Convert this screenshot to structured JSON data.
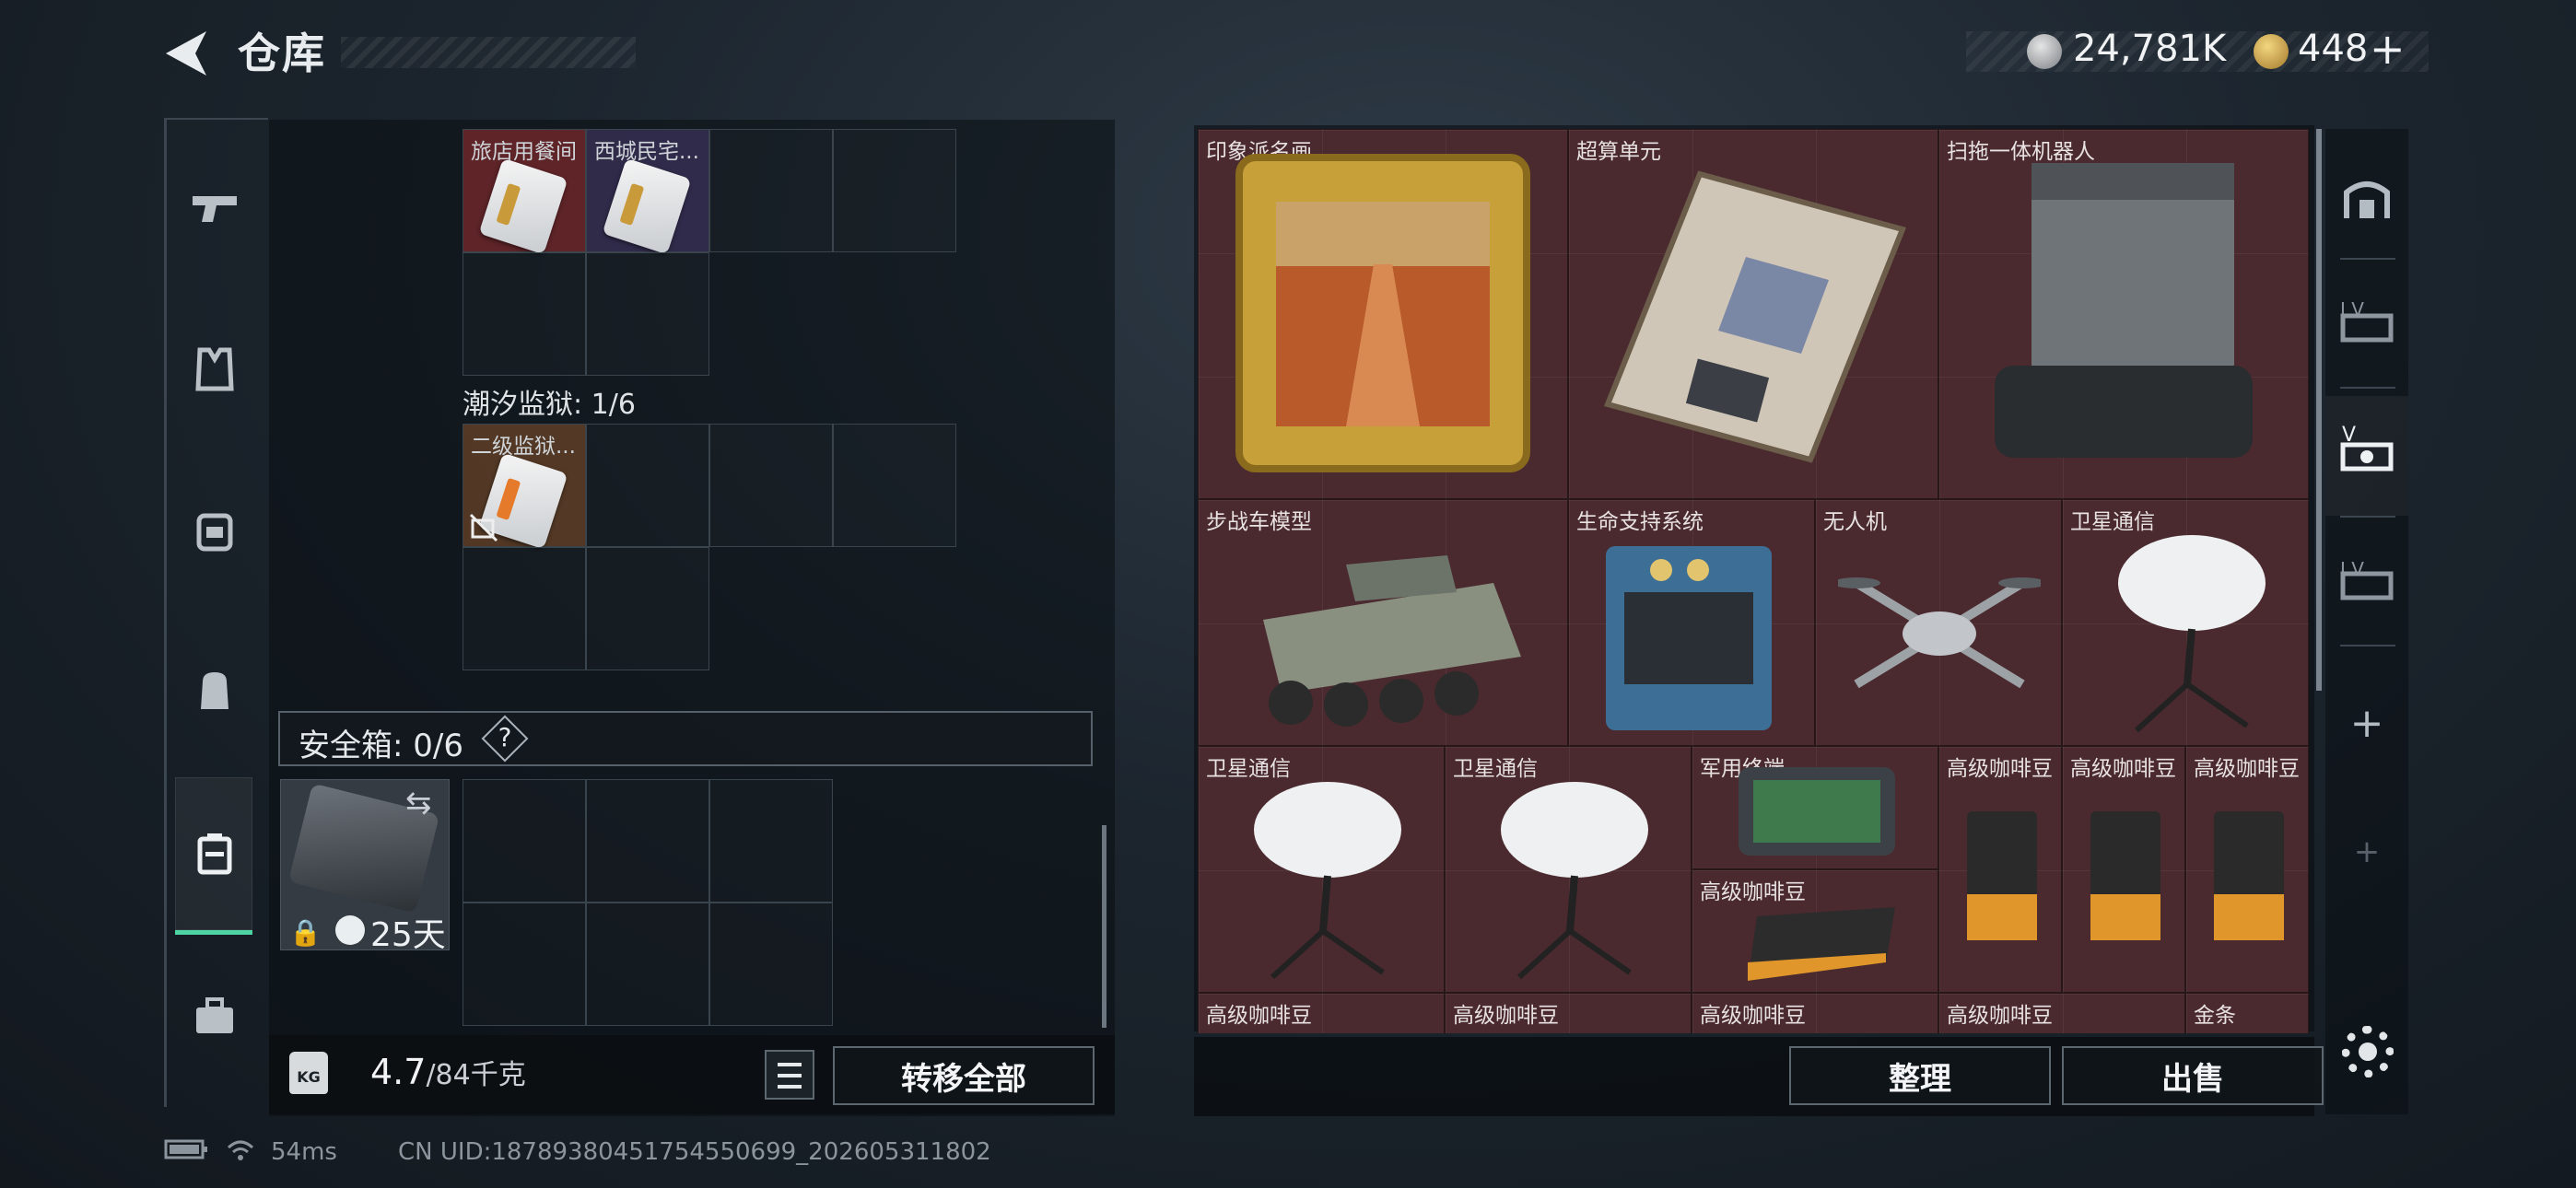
{
  "header": {
    "title": "仓库"
  },
  "currency": {
    "silver": "24,781K",
    "gold": "448",
    "add": "+"
  },
  "left_panel": {
    "top_items": [
      {
        "label": "旅店用餐间",
        "rarity_color": "#7a282c"
      },
      {
        "label": "西城民宅...",
        "rarity_color": "#3c325a"
      }
    ],
    "section_label": "潮汐监狱: 1/6",
    "section_items": [
      {
        "label": "二级监狱...",
        "rarity_color": "#6e4628"
      }
    ],
    "safe_box": {
      "label": "安全箱: 0/6",
      "help": "?"
    },
    "case": {
      "timer": "25天"
    },
    "weight": {
      "current": "4.7",
      "max": "/84千克",
      "icon": "KG"
    },
    "transfer_all": "转移全部"
  },
  "stash": {
    "items": [
      {
        "label": "印象派名画"
      },
      {
        "label": "超算单元"
      },
      {
        "label": "扫拖一体机器人"
      },
      {
        "label": "步战车模型"
      },
      {
        "label": "生命支持系统"
      },
      {
        "label": "无人机"
      },
      {
        "label": "卫星通信"
      },
      {
        "label": "卫星通信"
      },
      {
        "label": "卫星通信"
      },
      {
        "label": "军用终端"
      },
      {
        "label": "高级咖啡豆"
      },
      {
        "label": "高级咖啡豆"
      },
      {
        "label": "高级咖啡豆"
      },
      {
        "label": "高级咖啡豆"
      },
      {
        "label": "高级咖啡豆"
      },
      {
        "label": "高级咖啡豆"
      },
      {
        "label": "高级咖啡豆"
      },
      {
        "label": "高级咖啡豆"
      },
      {
        "label": "金条"
      }
    ],
    "sort_button": "整理",
    "sell_button": "出售"
  },
  "right_rail": {
    "tier_labels": [
      "I.V",
      "V",
      "I.V"
    ],
    "add": "+"
  },
  "status": {
    "ping": "54ms",
    "uid": "CN UID:18789380451754550699_202605311802"
  },
  "colors": {
    "accent": "#4ed4a2",
    "stash_bg": "#4a2a2f"
  }
}
